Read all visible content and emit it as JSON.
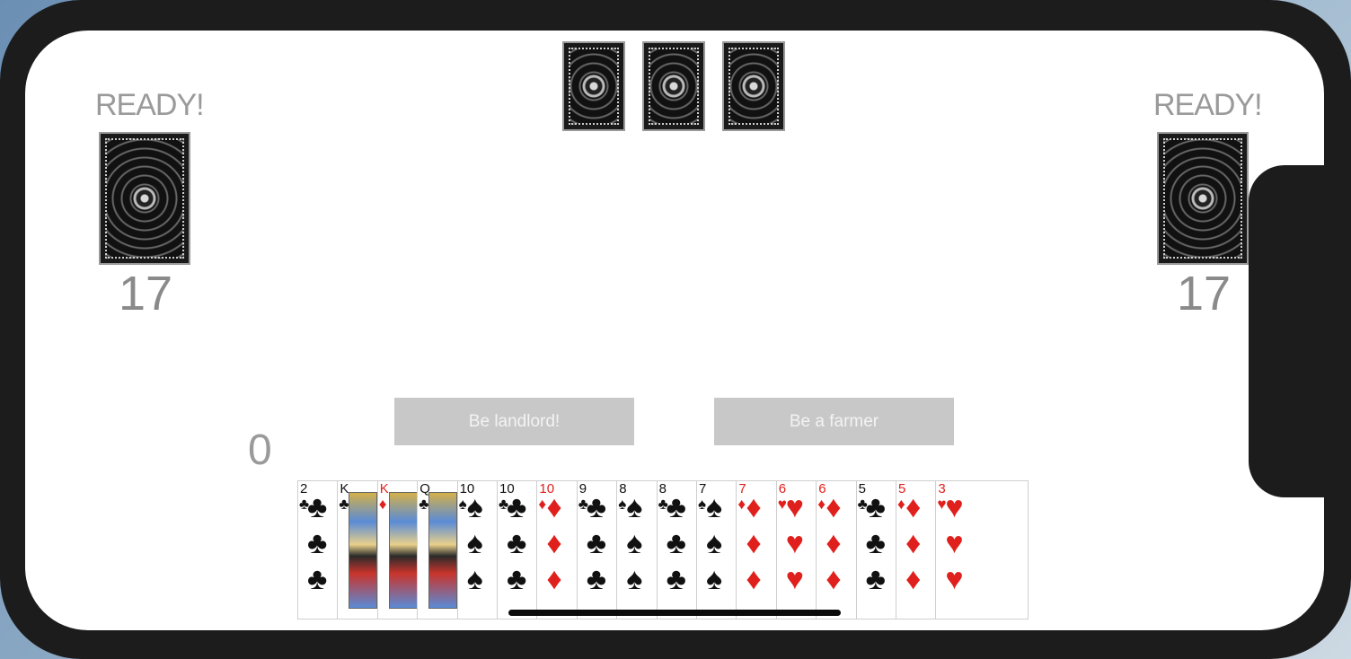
{
  "left_player": {
    "status": "READY!",
    "card_count": "17"
  },
  "right_player": {
    "status": "READY!",
    "card_count": "17"
  },
  "landlord_cards": [
    {
      "name": "card-back-1"
    },
    {
      "name": "card-back-2"
    },
    {
      "name": "card-back-3"
    }
  ],
  "buttons": {
    "landlord": "Be landlord!",
    "farmer": "Be a farmer"
  },
  "score": "0",
  "hand": [
    {
      "rank": "2",
      "suit": "♣",
      "color": "black"
    },
    {
      "rank": "K",
      "suit": "♣",
      "color": "black"
    },
    {
      "rank": "K",
      "suit": "♦",
      "color": "red"
    },
    {
      "rank": "Q",
      "suit": "♣",
      "color": "black"
    },
    {
      "rank": "10",
      "suit": "♠",
      "color": "black"
    },
    {
      "rank": "10",
      "suit": "♣",
      "color": "black"
    },
    {
      "rank": "10",
      "suit": "♦",
      "color": "red"
    },
    {
      "rank": "9",
      "suit": "♣",
      "color": "black"
    },
    {
      "rank": "8",
      "suit": "♠",
      "color": "black"
    },
    {
      "rank": "8",
      "suit": "♣",
      "color": "black"
    },
    {
      "rank": "7",
      "suit": "♠",
      "color": "black"
    },
    {
      "rank": "7",
      "suit": "♦",
      "color": "red"
    },
    {
      "rank": "6",
      "suit": "♥",
      "color": "red"
    },
    {
      "rank": "6",
      "suit": "♦",
      "color": "red"
    },
    {
      "rank": "5",
      "suit": "♣",
      "color": "black"
    },
    {
      "rank": "5",
      "suit": "♦",
      "color": "red"
    },
    {
      "rank": "3",
      "suit": "♥",
      "color": "red"
    }
  ]
}
